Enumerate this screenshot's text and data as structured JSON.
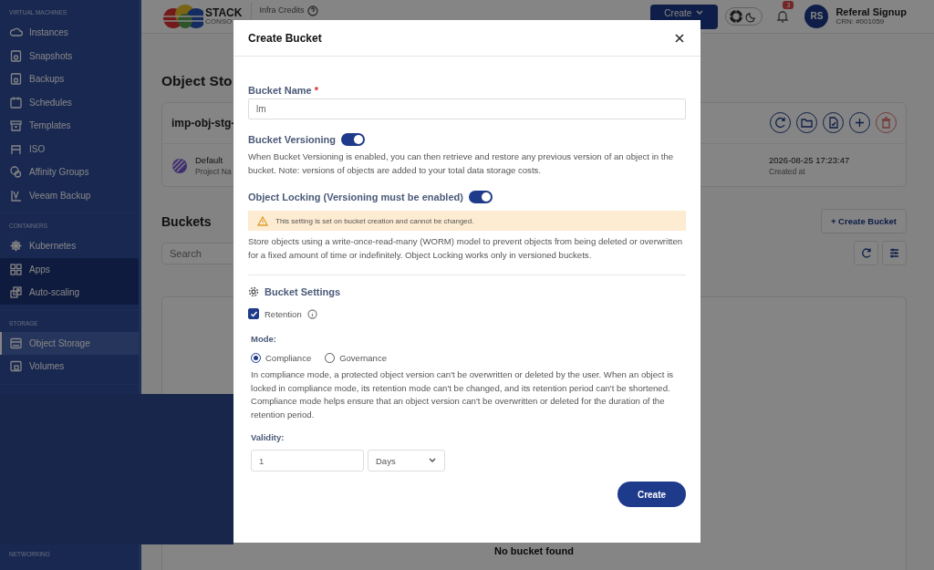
{
  "sidebar": {
    "sections": [
      {
        "title": "VIRTUAL MACHINES",
        "items": [
          {
            "label": "Instances",
            "selected": false
          },
          {
            "label": "Snapshots",
            "selected": false
          },
          {
            "label": "Backups",
            "selected": false
          },
          {
            "label": "Schedules",
            "selected": false
          },
          {
            "label": "Templates",
            "selected": false
          },
          {
            "label": "ISO",
            "selected": false
          },
          {
            "label": "Affinity Groups",
            "selected": false
          },
          {
            "label": "Veeam Backup",
            "selected": false
          }
        ]
      },
      {
        "title": "CONTAINERS",
        "items": [
          {
            "label": "Kubernetes",
            "selected": false,
            "expanded": true,
            "children": [
              {
                "label": "Apps",
                "selected": false
              },
              {
                "label": "Auto-scaling",
                "selected": false
              }
            ]
          }
        ]
      },
      {
        "title": "STORAGE",
        "items": [
          {
            "label": "Object Storage",
            "selected": true
          },
          {
            "label": "Volumes",
            "selected": false
          }
        ]
      },
      {
        "title": "NETWORKING"
      }
    ]
  },
  "topbar": {
    "logo_top": "STACK",
    "logo_bottom": "CONSO",
    "credits_label": "Infra Credits",
    "create_button": "Create",
    "dark_mode": false,
    "notification_count": "3",
    "avatar": "RS",
    "user_name": "Referal Signup",
    "crn": "CRN: #001059"
  },
  "page": {
    "title": "Object Sto",
    "storage": {
      "name": "imp-obj-stg-",
      "project": "Default",
      "project_label": "Project Na",
      "created": "2026-08-25 17:23:47",
      "created_label": "Created at"
    },
    "buckets_title": "Buckets",
    "search": {
      "placeholder": "Search"
    },
    "create_bucket_button": "+ Create Bucket",
    "empty_title": "No bucket found"
  },
  "modal": {
    "title": "Create Bucket",
    "bucket_name": {
      "label": "Bucket Name",
      "required_mark": "*",
      "value": "lm"
    },
    "versioning": {
      "label": "Bucket Versioning",
      "on": true,
      "description": "When Bucket Versioning is enabled, you can then retrieve and restore any previous version of an object in the bucket. Note: versions of objects are added to your total data storage costs."
    },
    "object_locking": {
      "label": "Object Locking (Versioning must be enabled)",
      "on": true,
      "warning": "This setting is set on bucket creation and cannot be changed.",
      "description": "Store objects using a write-once-read-many (WORM) model to prevent objects from being deleted or overwritten for a fixed amount of time or indefinitely. Object Locking works only in versioned buckets."
    },
    "settings_title": "Bucket Settings",
    "retention": {
      "label": "Retention",
      "checked": true
    },
    "mode": {
      "label": "Mode:",
      "options": [
        {
          "label": "Compliance",
          "selected": true
        },
        {
          "label": "Governance",
          "selected": false
        }
      ],
      "description": "In compliance mode, a protected object version can't be overwritten or deleted by the user. When an object is locked in compliance mode, its retention mode can't be changed, and its retention period can't be shortened. Compliance mode helps ensure that an object version can't be overwritten or deleted for the duration of the retention period."
    },
    "validity": {
      "label": "Validity:",
      "value": "1",
      "unit": "Days"
    },
    "create_button": "Create"
  }
}
